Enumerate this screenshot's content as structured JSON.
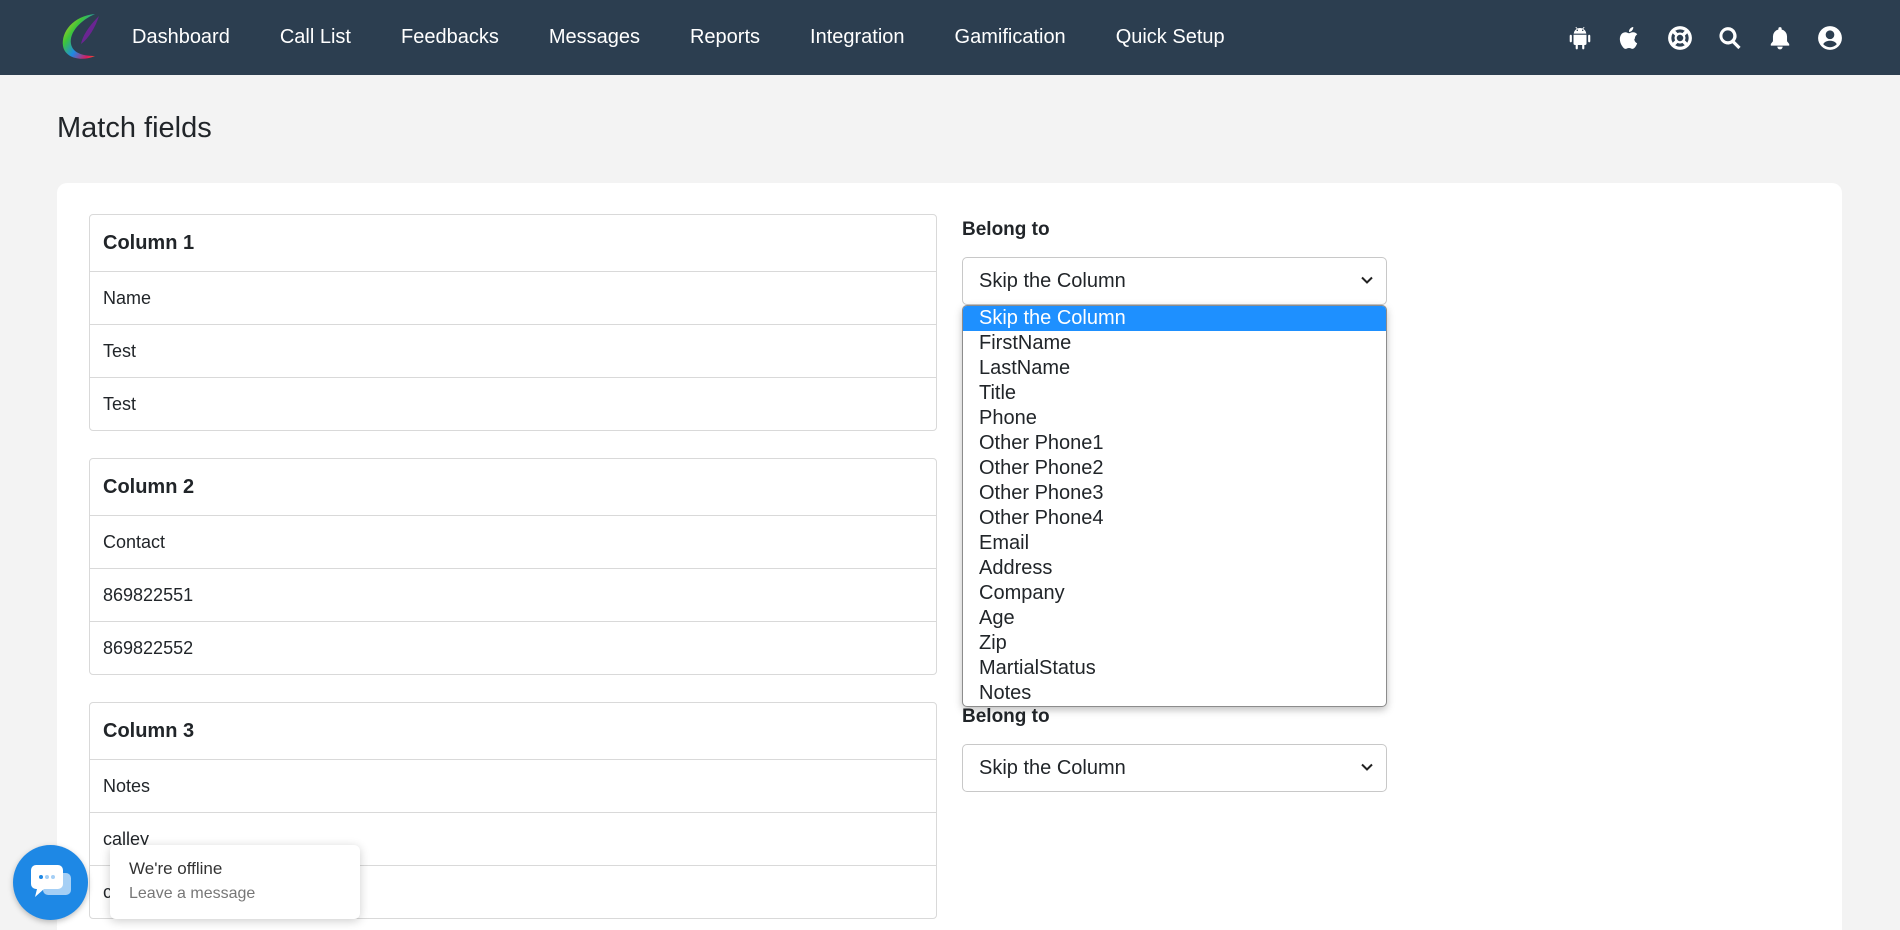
{
  "nav": {
    "links": [
      "Dashboard",
      "Call List",
      "Feedbacks",
      "Messages",
      "Reports",
      "Integration",
      "Gamification",
      "Quick Setup"
    ],
    "icons": [
      "android-icon",
      "apple-icon",
      "lifebuoy-icon",
      "search-icon",
      "bell-icon",
      "user-icon"
    ]
  },
  "page": {
    "title": "Match fields"
  },
  "columns": [
    {
      "header": "Column 1",
      "rows": [
        "Name",
        "Test",
        "Test"
      ]
    },
    {
      "header": "Column 2",
      "rows": [
        "Contact",
        "869822551",
        "869822552"
      ]
    },
    {
      "header": "Column 3",
      "rows": [
        "Notes",
        "calley",
        "c"
      ]
    }
  ],
  "belong": {
    "label": "Belong to",
    "selects": [
      {
        "label": "Belong to",
        "value": "Skip the Column"
      },
      {
        "label": "Belong to",
        "value": "Skip the Column"
      }
    ],
    "options": [
      "Skip the Column",
      "FirstName",
      "LastName",
      "Title",
      "Phone",
      "Other Phone1",
      "Other Phone2",
      "Other Phone3",
      "Other Phone4",
      "Email",
      "Address",
      "Company",
      "Age",
      "Zip",
      "MartialStatus",
      "Notes"
    ],
    "selected_option": "Skip the Column"
  },
  "chat": {
    "status": "We're offline",
    "cta": "Leave a message"
  },
  "colors": {
    "nav_bg": "#2c3e50",
    "accent": "#1e90ff",
    "chat": "#1e88e5"
  }
}
